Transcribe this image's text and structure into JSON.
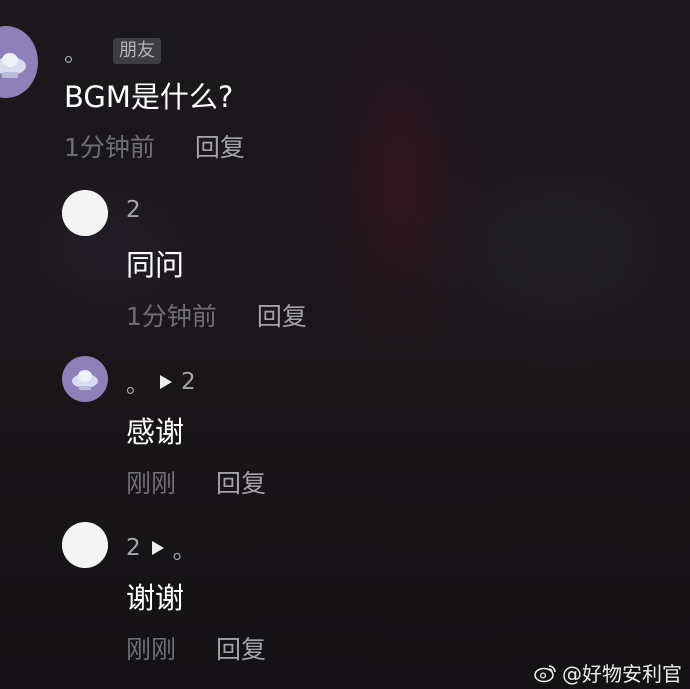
{
  "comments": [
    {
      "author": "。",
      "tag": "朋友",
      "text": "BGM是什么?",
      "time": "1分钟前",
      "reply_label": "回复",
      "avatar_icon": "ufo-cartoon-icon"
    },
    {
      "author": "2",
      "text": "同问",
      "time": "1分钟前",
      "reply_label": "回复",
      "avatar_icon": "blank-white-avatar"
    },
    {
      "author": "。",
      "reply_to": "2",
      "text": "感谢",
      "time": "刚刚",
      "reply_label": "回复",
      "avatar_icon": "ufo-cartoon-icon"
    },
    {
      "author": "2",
      "reply_to": "。",
      "text": "谢谢",
      "time": "刚刚",
      "reply_label": "回复",
      "avatar_icon": "blank-white-avatar"
    }
  ],
  "watermark": {
    "text": "@好物安利官",
    "icon": "weibo-icon"
  },
  "colors": {
    "background": "#1a1619",
    "time_text": "#6f6e75",
    "reply_text": "#a3a2a8",
    "tag_bg": "#3e3d44",
    "avatar_purple": "#8e80b8"
  }
}
